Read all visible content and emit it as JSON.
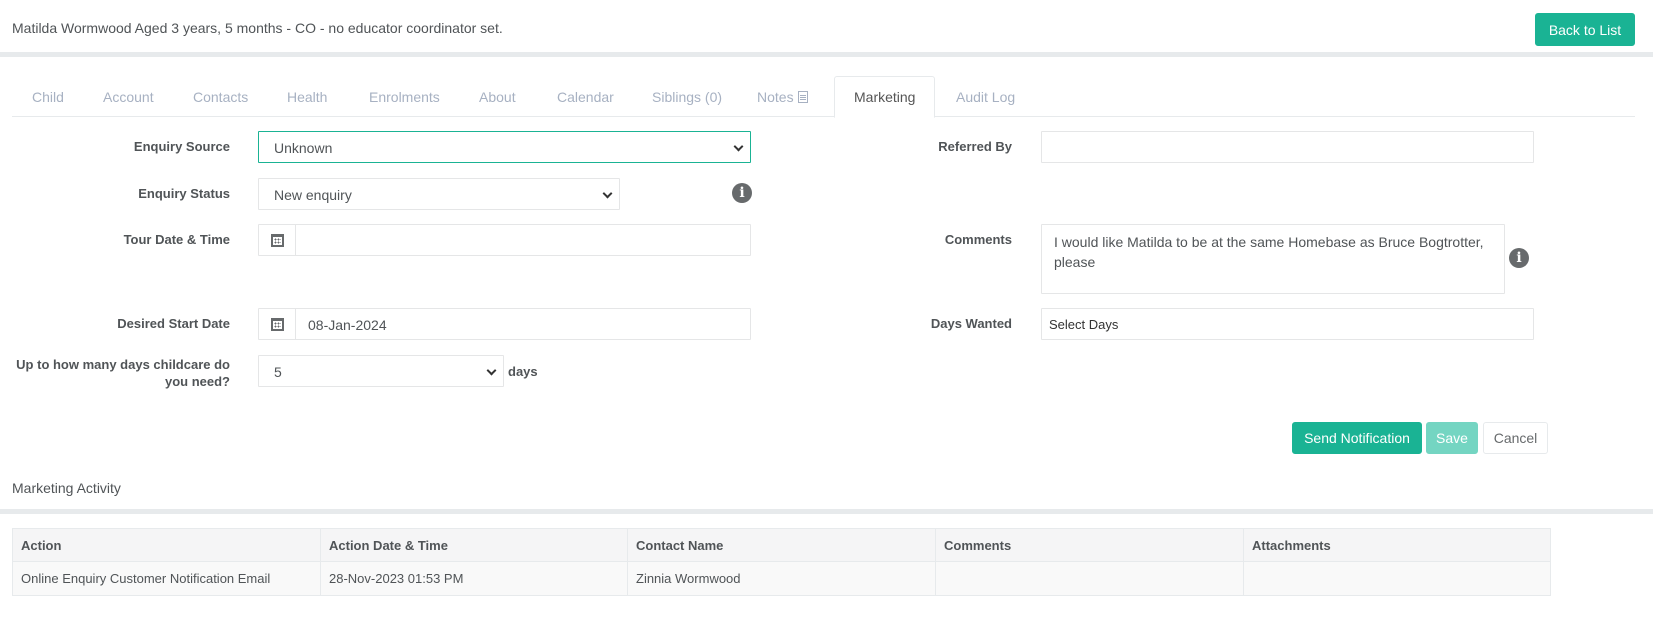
{
  "header": {
    "title": "Matilda Wormwood Aged 3 years, 5 months - CO - no educator coordinator set.",
    "back_label": "Back to List"
  },
  "tabs": [
    {
      "label": "Child"
    },
    {
      "label": "Account"
    },
    {
      "label": "Contacts"
    },
    {
      "label": "Health"
    },
    {
      "label": "Enrolments"
    },
    {
      "label": "About"
    },
    {
      "label": "Calendar"
    },
    {
      "label": "Siblings (0)"
    },
    {
      "label": "Notes",
      "icon": "document-icon"
    },
    {
      "label": "Marketing",
      "active": true
    },
    {
      "label": "Audit Log"
    }
  ],
  "form": {
    "enquiry_source": {
      "label": "Enquiry Source",
      "value": "Unknown"
    },
    "enquiry_status": {
      "label": "Enquiry Status",
      "value": "New enquiry",
      "icon": "info-icon"
    },
    "tour_date": {
      "label": "Tour Date & Time",
      "value": "",
      "icon": "calendar-icon"
    },
    "desired_start": {
      "label": "Desired Start Date",
      "value": "08-Jan-2024",
      "icon": "calendar-icon"
    },
    "days_needed": {
      "label": "Up to how many days childcare do you need?",
      "value": "5",
      "suffix": "days"
    },
    "referred_by": {
      "label": "Referred By",
      "value": ""
    },
    "comments": {
      "label": "Comments",
      "value": "I would like Matilda to be at the same Homebase as Bruce Bogtrotter, please",
      "icon": "info-icon"
    },
    "days_wanted": {
      "label": "Days Wanted",
      "value": "Select Days"
    }
  },
  "actions": {
    "send_label": "Send Notification",
    "save_label": "Save",
    "cancel_label": "Cancel"
  },
  "activity": {
    "title": "Marketing Activity",
    "columns": [
      "Action",
      "Action Date & Time",
      "Contact Name",
      "Comments",
      "Attachments"
    ],
    "rows": [
      [
        "Online Enquiry Customer Notification Email",
        "28-Nov-2023 01:53 PM",
        "Zinnia Wormwood",
        "",
        ""
      ]
    ]
  },
  "colors": {
    "primary": "#1ab394",
    "primary_disabled": "#74d5c2",
    "tab_inactive": "#a7b1c2"
  }
}
